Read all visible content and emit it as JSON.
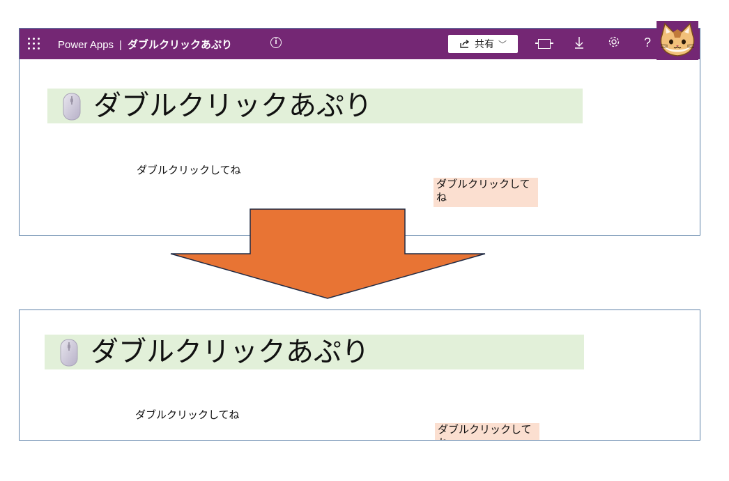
{
  "header": {
    "product": "Power Apps",
    "separator": "|",
    "app_name": "ダブルクリックあぷり",
    "info_glyph": "i",
    "share_label": "共有",
    "background": "#742774"
  },
  "app": {
    "title": "ダブルクリックあぷり",
    "label_a": "ダブルクリックしてね",
    "label_b": "ダブルクリックしてね",
    "title_bg": "#e2f0d9",
    "label_b_bg": "#fbdfd0"
  },
  "arrow": {
    "color": "#e87434",
    "direction": "down"
  },
  "icons": [
    "waffle-icon",
    "info-icon",
    "share-icon",
    "chevron-down-icon",
    "fit-to-window-icon",
    "download-icon",
    "gear-icon",
    "help-icon",
    "cat-avatar",
    "mouse-icon"
  ]
}
